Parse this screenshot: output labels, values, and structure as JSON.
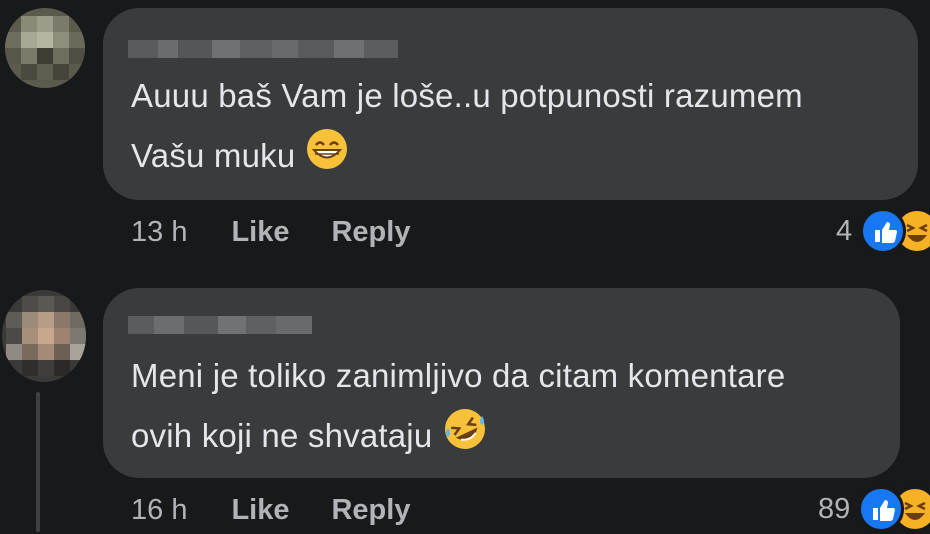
{
  "comments": [
    {
      "text_line1": "Auuu baš Vam je loše..u potpunosti razumem",
      "text_line2": "Vašu muku",
      "emoji": "grinning-face-with-smiling-eyes",
      "time": "13 h",
      "like_label": "Like",
      "reply_label": "Reply",
      "reaction_count": "4",
      "reactions": [
        "like",
        "haha"
      ]
    },
    {
      "text_line1": "Meni je toliko zanimljivo da citam komentare",
      "text_line2": "ovih koji ne shvataju",
      "emoji": "rolling-on-the-floor-laughing",
      "time": "16 h",
      "like_label": "Like",
      "reply_label": "Reply",
      "reaction_count": "89",
      "reactions": [
        "like",
        "haha"
      ]
    }
  ],
  "colors": {
    "background": "#18191a",
    "bubble": "#3a3b3c",
    "text": "#e4e6eb",
    "meta": "#b0b3b8",
    "like_blue": "#1877f2",
    "haha_yellow": "#f7b125"
  }
}
